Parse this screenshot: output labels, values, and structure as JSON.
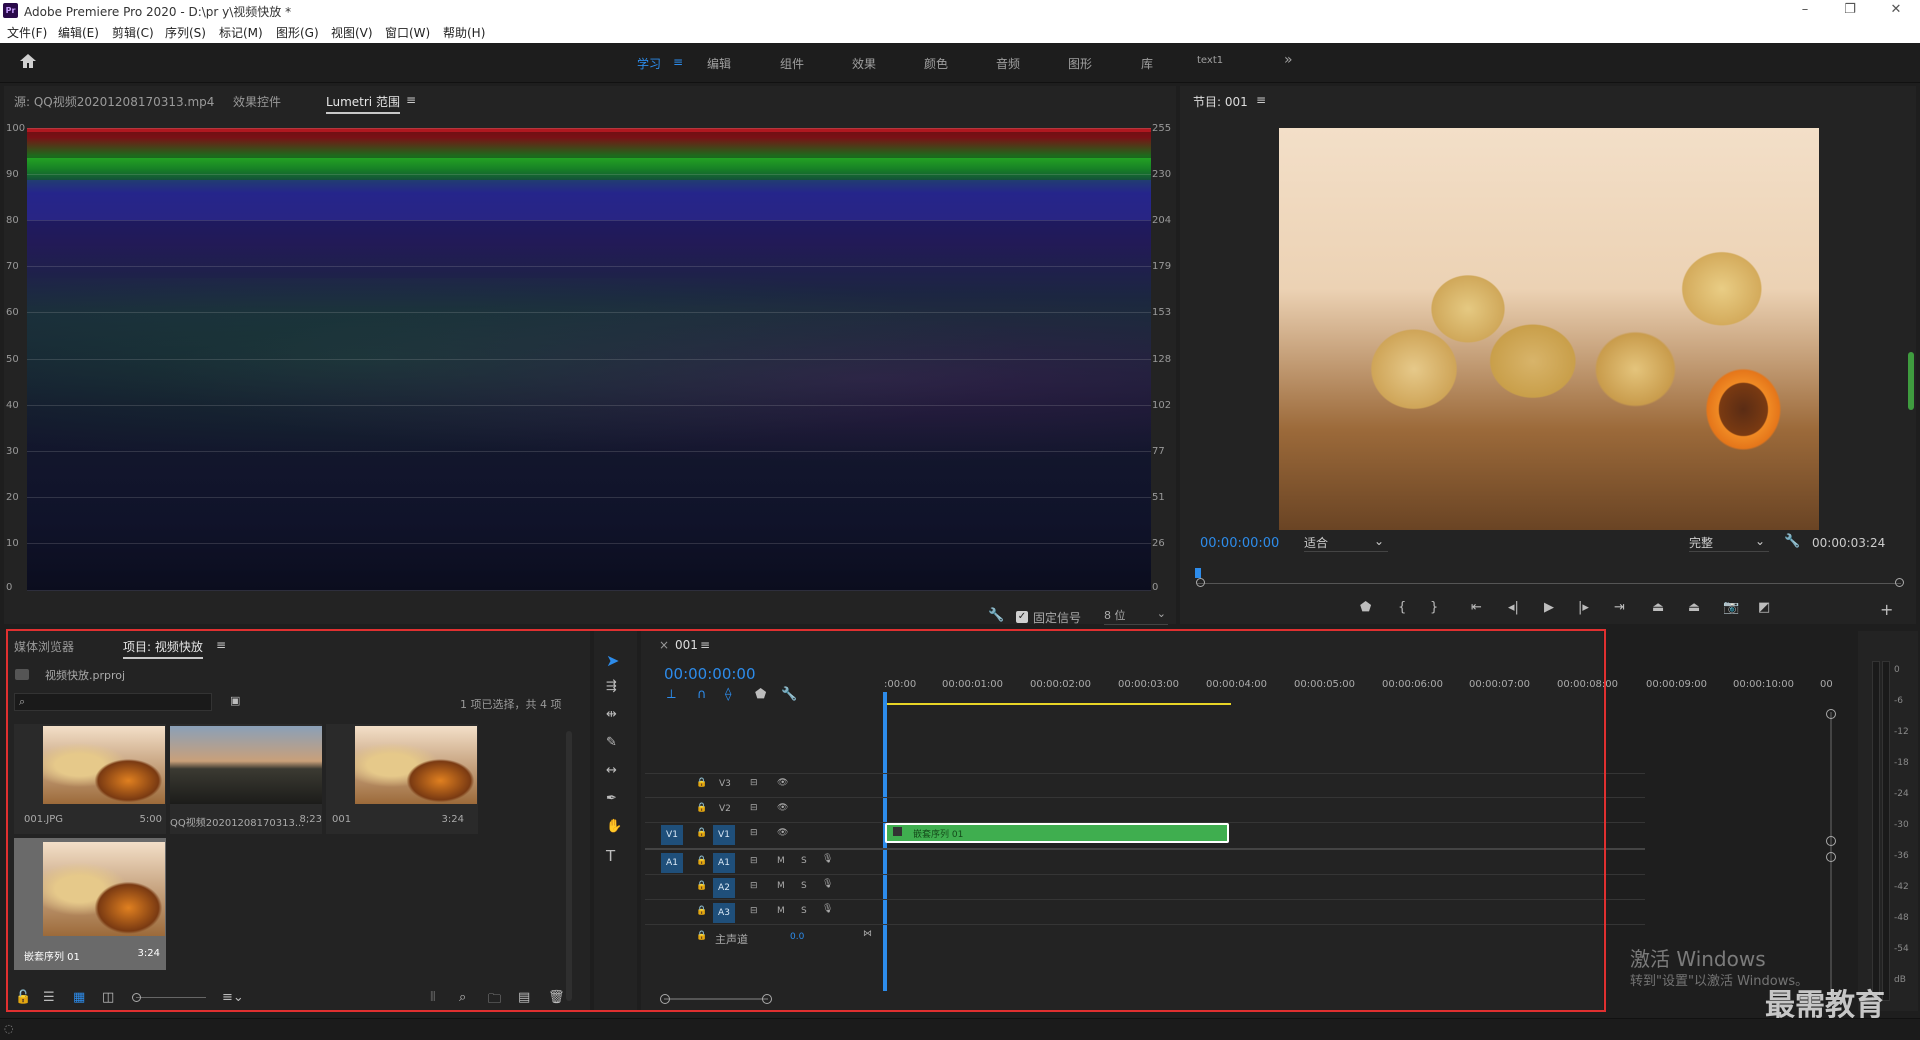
{
  "app": {
    "title": "Adobe Premiere Pro 2020 - D:\\pr y\\视频快放 *",
    "logo": "Pr"
  },
  "window_controls": {
    "minimize": "–",
    "restore": "❐",
    "close": "✕"
  },
  "menu": [
    "文件(F)",
    "编辑(E)",
    "剪辑(C)",
    "序列(S)",
    "标记(M)",
    "图形(G)",
    "视图(V)",
    "窗口(W)",
    "帮助(H)"
  ],
  "workspaces": {
    "items": [
      "学习",
      "编辑",
      "组件",
      "效果",
      "颜色",
      "音频",
      "图形",
      "库",
      "text1"
    ],
    "active": "学习",
    "more": "»"
  },
  "source_panel": {
    "tabs": [
      "源: QQ视频20201208170313.mp4",
      "效果控件",
      "Lumetri 范围"
    ],
    "active_tab": "Lumetri 范围",
    "scope_left_ticks": [
      "100",
      "90",
      "80",
      "70",
      "60",
      "50",
      "40",
      "30",
      "20",
      "10",
      "0"
    ],
    "scope_right_ticks": [
      "255",
      "230",
      "204",
      "179",
      "153",
      "128",
      "102",
      "77",
      "51",
      "26",
      "0"
    ],
    "clamp_label": "固定信号",
    "bit_depth": "8 位"
  },
  "program_panel": {
    "title": "节目: 001",
    "timecode_in": "00:00:00:00",
    "fit": "适合",
    "quality": "完整",
    "duration": "00:00:03:24"
  },
  "project_panel": {
    "tabs": [
      "媒体浏览器",
      "项目: 视频快放"
    ],
    "active_tab": "项目: 视频快放",
    "file": "视频快放.prproj",
    "selection_info": "1 项已选择，共 4 项",
    "search_placeholder": "",
    "items": [
      {
        "name": "001.JPG",
        "duration": "5:00"
      },
      {
        "name": "QQ视频20201208170313...",
        "duration": "8;23"
      },
      {
        "name": "001",
        "duration": "3:24"
      },
      {
        "name": "嵌套序列 01",
        "duration": "3:24"
      }
    ]
  },
  "timeline": {
    "sequence": "001",
    "timecode": "00:00:00:00",
    "ruler": [
      ":00:00",
      "00:00:01:00",
      "00:00:02:00",
      "00:00:03:00",
      "00:00:04:00",
      "00:00:05:00",
      "00:00:06:00",
      "00:00:07:00",
      "00:00:08:00",
      "00:00:09:00",
      "00:00:10:00",
      "00"
    ],
    "video_tracks": [
      "V3",
      "V2",
      "V1"
    ],
    "audio_tracks": [
      "A1",
      "A2",
      "A3"
    ],
    "source_v": "V1",
    "source_a": "A1",
    "master_label": "主声道",
    "master_value": "0.0",
    "clip_name": "嵌套序列 01",
    "m_label": "M",
    "s_label": "S"
  },
  "vu_meter": {
    "ticks": [
      "0",
      "-6",
      "-12",
      "-18",
      "-24",
      "-30",
      "-36",
      "-42",
      "-48",
      "-54",
      "dB"
    ]
  },
  "watermark": {
    "line1": "激活 Windows",
    "line2": "转到\"设置\"以激活 Windows。",
    "brand": "最需教育"
  },
  "colors": {
    "accent_blue": "#2d8ceb",
    "clip_green": "#3fae4f",
    "highlight_red": "#e03030"
  }
}
